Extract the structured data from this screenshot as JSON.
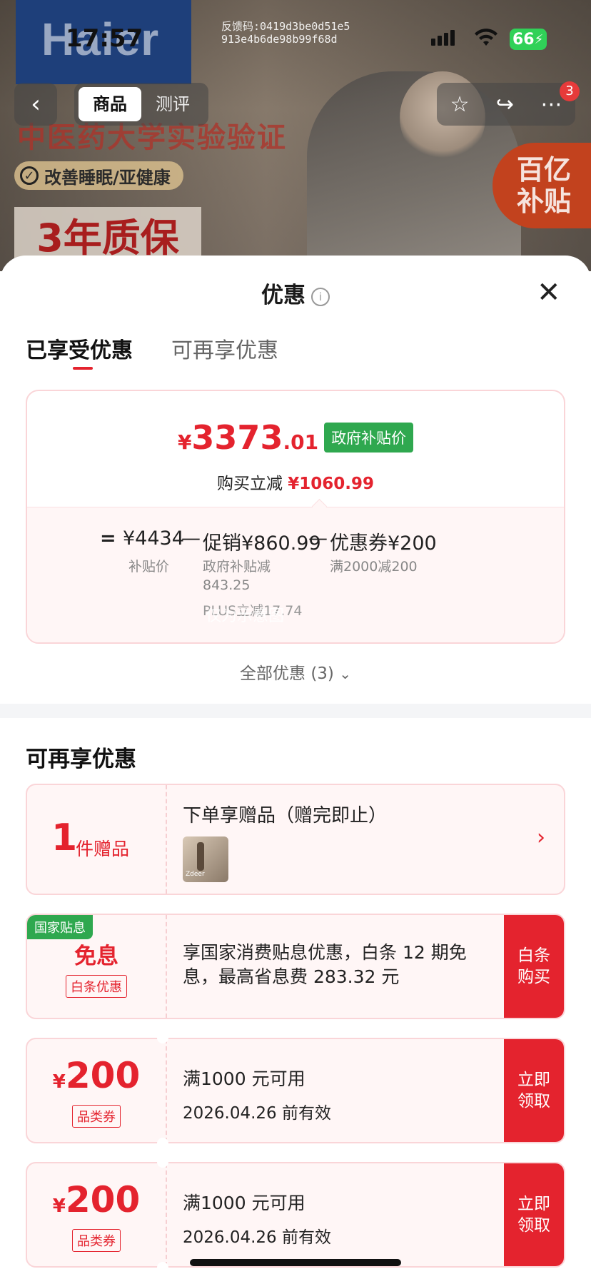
{
  "status_bar": {
    "time": "17:57",
    "feedback_line1": "反馈码:0419d3be0d51e5",
    "feedback_line2": "913e4b6de98b99f68d",
    "battery": "66"
  },
  "product_bg": {
    "logo": "Haier",
    "headline": "中医药大学实验验证",
    "pill": "改善睡眠/亚健康",
    "warranty": "3年质保",
    "subsidy_line1": "百亿",
    "subsidy_line2": "补贴"
  },
  "nav": {
    "tabs": [
      "商品",
      "测评"
    ],
    "badge": "3"
  },
  "sheet": {
    "title": "优惠",
    "tabs": [
      "已享受优惠",
      "可再享优惠"
    ]
  },
  "summary": {
    "currency": "¥",
    "price_int": "3373",
    "price_dec": ".01",
    "price_tag": "政府补贴价",
    "instant_label": "购买立减",
    "instant_value": "¥1060.99",
    "breakdown": {
      "eq": "=",
      "base": "¥4434",
      "base_label": "补贴价",
      "minus1": "—",
      "promo": "促销¥860.99",
      "promo_sub1": "政府补贴减",
      "promo_sub2": "843.25",
      "promo_sub3": "PLUS立减17.74",
      "minus2": "—",
      "coupon": "优惠券¥200",
      "coupon_sub": "满2000减200"
    },
    "watermark": "仅为示意图"
  },
  "all_offers": "全部优惠 (3)",
  "more_section": {
    "title": "可再享优惠",
    "gift": {
      "count": "1",
      "unit": "件赠品",
      "title": "下单享赠品（赠完即止）",
      "thumb_caption": "Zdeer"
    },
    "interest": {
      "corner": "国家贴息",
      "title": "免息",
      "tag": "白条优惠",
      "desc": "享国家消费贴息优惠，白条 12 期免息，最高省息费 283.32 元",
      "cta": "白条购买"
    },
    "coupons": [
      {
        "currency": "¥",
        "amount": "200",
        "tag": "品类券",
        "cond": "满1000 元可用",
        "valid": "2026.04.26 前有效",
        "cta": "立即领取"
      },
      {
        "currency": "¥",
        "amount": "200",
        "tag": "品类券",
        "cond": "满1000 元可用",
        "valid": "2026.04.26 前有效",
        "cta": "立即领取"
      }
    ]
  },
  "colors": {
    "accent_red": "#e4232e",
    "gov_green": "#2fa84f",
    "card_border": "#fad5d8"
  }
}
